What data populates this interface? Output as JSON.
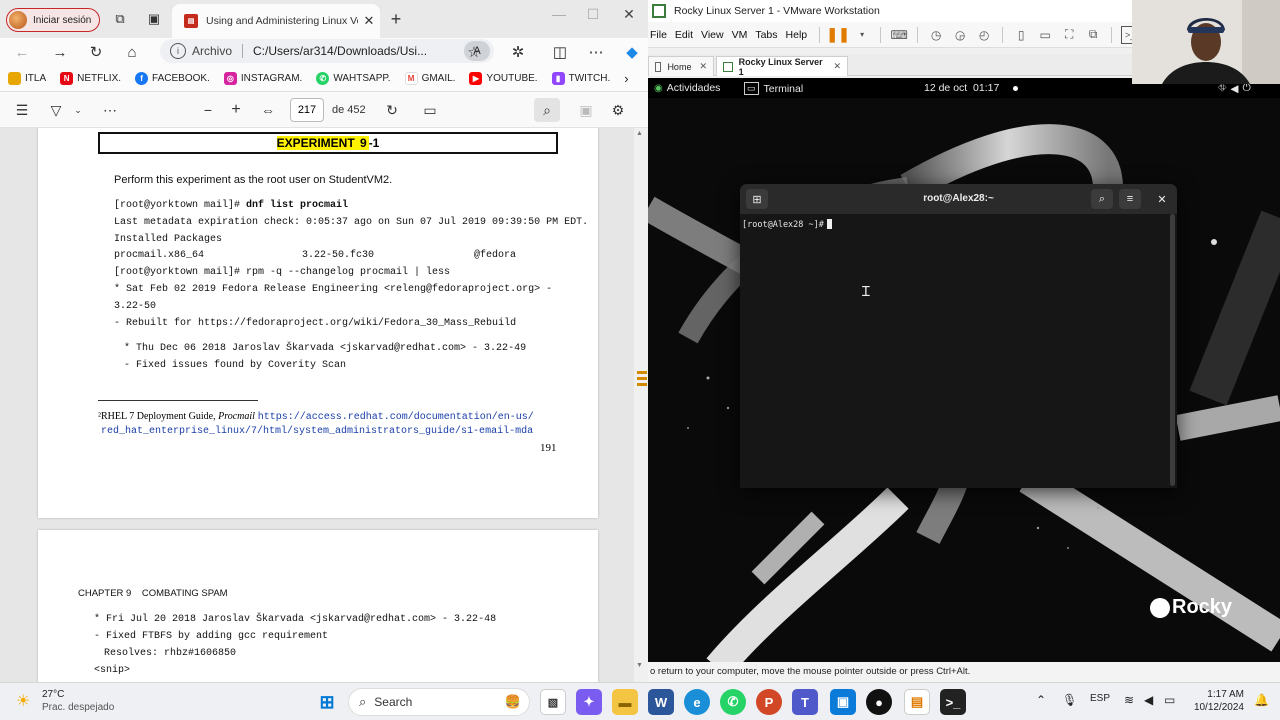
{
  "edge": {
    "profile_label": "Iniciar sesión",
    "tab_title": "Using and Administering Linux Vo",
    "address_prefix": "Archivo",
    "address_url": "C:/Users/ar314/Downloads/Usi...",
    "favorites": [
      "ITLA",
      "NETFLIX.",
      "FACEBOOK.",
      "INSTAGRAM.",
      "WAHTSAPP.",
      "GMAIL.",
      "YOUTUBE.",
      "TWITCH."
    ],
    "pdf_toolbar": {
      "minus": "−",
      "plus": "+",
      "page_current": "217",
      "page_total": "de 452"
    }
  },
  "pdf": {
    "experiment_prefix": "EXPERIMENT ",
    "experiment_hl": "9",
    "experiment_suffix": "-1",
    "intro": "Perform this experiment as the root user on StudentVM2.",
    "lines": {
      "l1_prompt": "[root@yorktown mail]# ",
      "l1_cmd": "dnf list procmail",
      "l2": "Last metadata expiration check: 0:05:37 ago on Sun 07 Jul 2019 09:39:50 PM EDT.",
      "l3": "Installed Packages",
      "l4a": "procmail.x86_64",
      "l4b": "3.22-50.fc30",
      "l4c": "@fedora",
      "l5": "[root@yorktown mail]# rpm -q --changelog procmail | less",
      "l6": "* Sat Feb 02 2019 Fedora Release Engineering <releng@fedoraproject.org> -",
      "l7": "3.22-50",
      "l8": "- Rebuilt for https://fedoraproject.org/wiki/Fedora_30_Mass_Rebuild",
      "l9": "* Thu Dec 06 2018 Jaroslav Škarvada <jskarvad@redhat.com> - 3.22-49",
      "l10": "- Fixed issues found by Coverity Scan"
    },
    "footnote_prefix": "²RHEL 7 Deployment Guide, ",
    "footnote_italic": "Procmail",
    "footnote_link1": "https://access.redhat.com/documentation/en-us/",
    "footnote_link2": "red_hat_enterprise_linux/7/html/system_administrators_guide/s1-email-mda",
    "page_number": "191",
    "page2": {
      "chapter": "CHAPTER 9",
      "chapter_title": "COMBATING SPAM",
      "l1": "* Fri Jul 20 2018 Jaroslav Škarvada <jskarvad@redhat.com> - 3.22-48",
      "l2": "- Fixed FTBFS by adding gcc requirement",
      "l3": "Resolves: rhbz#1606850",
      "l4": "<snip>"
    }
  },
  "vmware": {
    "window_title": "Rocky Linux Server 1 - VMware Workstation",
    "menu": [
      "File",
      "Edit",
      "View",
      "VM",
      "Tabs",
      "Help"
    ],
    "tabs": [
      "Home",
      "Rocky Linux Server 1"
    ],
    "status_text": "o return to your computer, move the mouse pointer outside or press Ctrl+Alt."
  },
  "guest": {
    "activities": "Actividades",
    "app_name": "Terminal",
    "datetime": "12 de oct  01:17",
    "terminal_title": "root@Alex28:~",
    "prompt": "[root@Alex28 ~]#",
    "brand": "Rocky"
  },
  "taskbar": {
    "temperature": "27°C",
    "weather": "Prac. despejado",
    "search_label": "Search",
    "language": "ESP",
    "time": "1:17 AM",
    "date": "10/12/2024"
  },
  "colors": {
    "highlight": "#fff200",
    "link": "#1a3ea8",
    "vmware_pause": "#e07b00",
    "terminal_bg": "#161616"
  }
}
